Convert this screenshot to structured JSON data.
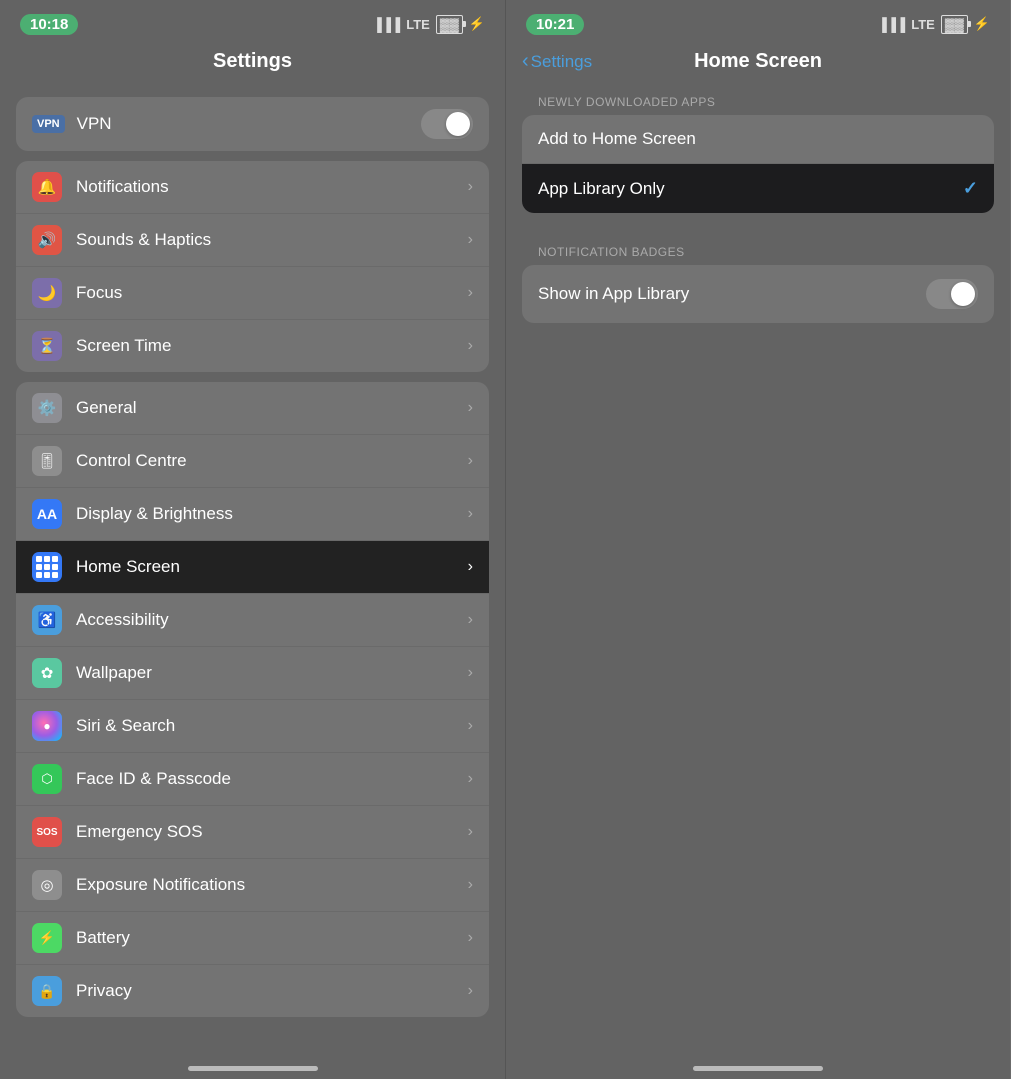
{
  "left_panel": {
    "status": {
      "time": "10:18",
      "signal": "📶",
      "lte": "LTE",
      "battery": "🔋"
    },
    "title": "Settings",
    "vpn_section": {
      "vpn_label": "VPN",
      "vpn_badge": "VPN"
    },
    "section1": [
      {
        "label": "Notifications",
        "icon_color": "icon-red",
        "icon_char": "🔔"
      },
      {
        "label": "Sounds & Haptics",
        "icon_color": "icon-orange-red",
        "icon_char": "🔊"
      },
      {
        "label": "Focus",
        "icon_color": "icon-purple",
        "icon_char": "🌙"
      },
      {
        "label": "Screen Time",
        "icon_color": "icon-purple2",
        "icon_char": "⏳"
      }
    ],
    "section2": [
      {
        "label": "General",
        "icon_color": "icon-gray",
        "icon_char": "⚙️"
      },
      {
        "label": "Control Centre",
        "icon_color": "icon-gray2",
        "icon_char": "🎛"
      },
      {
        "label": "Display & Brightness",
        "icon_color": "icon-blue3",
        "icon_char": "A"
      },
      {
        "label": "Home Screen",
        "icon_color": "icon-homescreen",
        "icon_char": "⠿",
        "highlighted": true
      },
      {
        "label": "Accessibility",
        "icon_color": "icon-blue2",
        "icon_char": "♿"
      },
      {
        "label": "Wallpaper",
        "icon_color": "icon-teal",
        "icon_char": "❀"
      },
      {
        "label": "Siri & Search",
        "icon_color": "icon-pink",
        "icon_char": "◉"
      },
      {
        "label": "Face ID & Passcode",
        "icon_color": "icon-green2",
        "icon_char": "⬛"
      },
      {
        "label": "Emergency SOS",
        "icon_color": "icon-red",
        "icon_char": "SOS"
      },
      {
        "label": "Exposure Notifications",
        "icon_color": "icon-gray2",
        "icon_char": "◎"
      },
      {
        "label": "Battery",
        "icon_color": "icon-green",
        "icon_char": "🔋"
      },
      {
        "label": "Privacy",
        "icon_color": "icon-blue",
        "icon_char": "🔒"
      }
    ]
  },
  "right_panel": {
    "status": {
      "time": "10:21",
      "signal": "📶",
      "lte": "LTE",
      "battery": "🔋"
    },
    "back_label": "Settings",
    "title": "Home Screen",
    "newly_downloaded": {
      "section_header": "NEWLY DOWNLOADED APPS",
      "options": [
        {
          "label": "Add to Home Screen",
          "selected": false
        },
        {
          "label": "App Library Only",
          "selected": true
        }
      ]
    },
    "notification_badges": {
      "section_header": "NOTIFICATION BADGES",
      "rows": [
        {
          "label": "Show in App Library",
          "has_toggle": true
        }
      ]
    }
  }
}
